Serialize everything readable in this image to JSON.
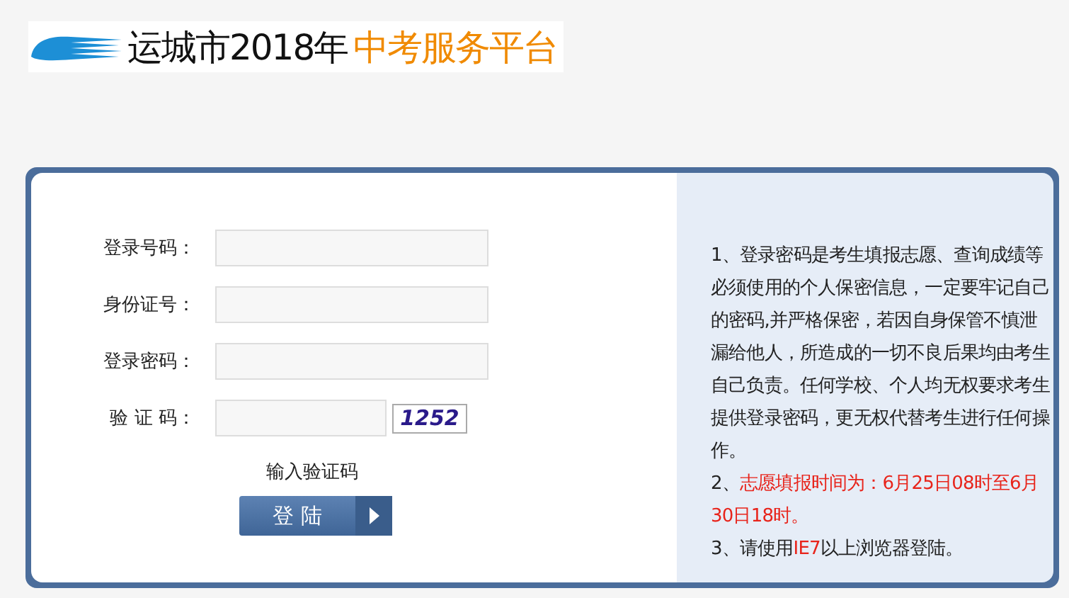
{
  "header": {
    "title": "运城市2018年",
    "subtitle": "中考服务平台"
  },
  "form": {
    "fields": [
      {
        "label": "登录号码：",
        "kind": "text"
      },
      {
        "label": "身份证号：",
        "kind": "text"
      },
      {
        "label": "登录密码：",
        "kind": "text"
      },
      {
        "label": "验 证 码：",
        "kind": "captcha",
        "captcha": "1252"
      }
    ],
    "captcha_hint": "输入验证码",
    "submit": "登 陆"
  },
  "notes": [
    [
      {
        "kind": "plain",
        "text": "1、登录密码是考生填报志愿、查询成绩等必须使用的个人保密信息，一定要牢记自己的密码,并严格保密，若因自身保管不慎泄漏给他人，所造成的一切不良后果均由考生自己负责。任何学校、个人均无权要求考生提供登录密码，更无权代替考生进行任何操作。"
      }
    ],
    [
      {
        "kind": "plain",
        "text": "2、"
      },
      {
        "kind": "highlight",
        "text": "志愿填报时间为：6月25日08时至6月30日18时。"
      }
    ],
    [
      {
        "kind": "plain",
        "text": "3、请使用"
      },
      {
        "kind": "highlight",
        "text": "IE7"
      },
      {
        "kind": "plain",
        "text": "以上浏览器登陆。"
      }
    ]
  ]
}
